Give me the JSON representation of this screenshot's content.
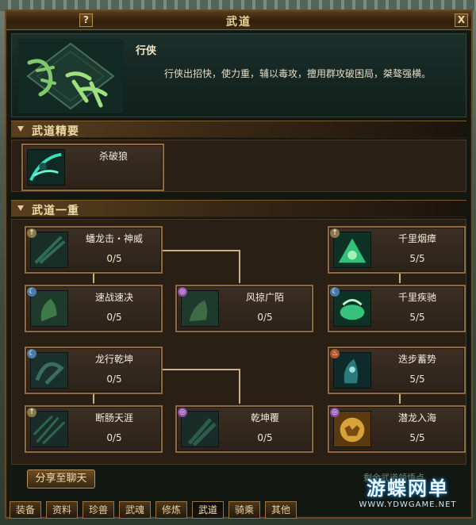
{
  "window": {
    "title": "武道",
    "help_label": "?",
    "close_label": "X"
  },
  "header": {
    "name": "行侠",
    "description": "行侠出招快，使力重，辅以毒攻，擅用群攻破困局，桀骜强横。",
    "emblem_text": "行侠"
  },
  "sections": {
    "essence_title": "武道精要",
    "tier1_title": "武道一重"
  },
  "essence_skill": {
    "name": "杀破狼",
    "icon": "wolf-slash-icon"
  },
  "skills": [
    {
      "id": "panlong",
      "name": "蟠龙击・神威",
      "level": "0/5",
      "icon": "dragon-strike-icon",
      "badge": "↑",
      "badge_color": "#8a7a4a"
    },
    {
      "id": "suzhan",
      "name": "速战速决",
      "level": "0/5",
      "icon": "quick-battle-icon",
      "badge": "☾",
      "badge_color": "#4a7aa5"
    },
    {
      "id": "fengjuan",
      "name": "风掠广陌",
      "level": "0/5",
      "icon": "wind-sweep-icon",
      "badge": "◎",
      "badge_color": "#8a4aa5"
    },
    {
      "id": "qianliyan",
      "name": "千里烟瘴",
      "level": "5/5",
      "icon": "miasma-icon",
      "badge": "↑",
      "badge_color": "#8a7a4a"
    },
    {
      "id": "qianlichi",
      "name": "千里疾驰",
      "level": "5/5",
      "icon": "gallop-icon",
      "badge": "☾",
      "badge_color": "#4a7aa5"
    },
    {
      "id": "longxing",
      "name": "龙行乾坤",
      "level": "0/5",
      "icon": "dragon-walk-icon",
      "badge": "☾",
      "badge_color": "#4a7aa5"
    },
    {
      "id": "duanchang",
      "name": "断肠天涯",
      "level": "0/5",
      "icon": "heartbreak-icon",
      "badge": "↑",
      "badge_color": "#8a7a4a"
    },
    {
      "id": "qiankunfu",
      "name": "乾坤覆",
      "level": "0/5",
      "icon": "heaven-cover-icon",
      "badge": "◎",
      "badge_color": "#8a4aa5"
    },
    {
      "id": "diebu",
      "name": "迭步蓄势",
      "level": "5/5",
      "icon": "step-charge-icon",
      "badge": "♨",
      "badge_color": "#b0542a"
    },
    {
      "id": "qianlong",
      "name": "潜龙入海",
      "level": "5/5",
      "icon": "hidden-dragon-icon",
      "badge": "◎",
      "badge_color": "#8a4aa5"
    }
  ],
  "share_button": "分享至聊天",
  "remaining_points_label": "剩余武道领悟点",
  "tabs": [
    "装备",
    "资料",
    "珍兽",
    "武魂",
    "修炼",
    "武道",
    "骑乘",
    "其他"
  ],
  "active_tab": "武道",
  "watermark": {
    "main": "游蝶网单",
    "sub": "WWW.YDWGAME.NET"
  }
}
